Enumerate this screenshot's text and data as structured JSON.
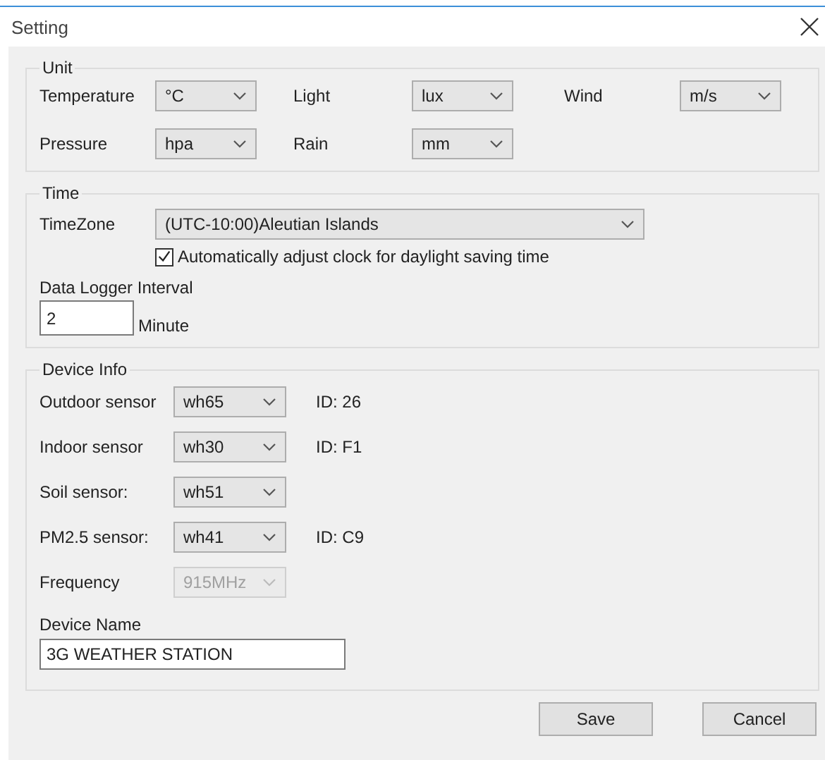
{
  "window": {
    "title": "Setting"
  },
  "unit": {
    "title": "Unit",
    "fields": [
      {
        "label": "Temperature",
        "value": "°C"
      },
      {
        "label": "Light",
        "value": "lux"
      },
      {
        "label": "Wind",
        "value": "m/s"
      },
      {
        "label": "Pressure",
        "value": "hpa"
      },
      {
        "label": "Rain",
        "value": "mm"
      }
    ]
  },
  "time": {
    "title": "Time",
    "timezone_label": "TimeZone",
    "timezone": "(UTC-10:00)Aleutian Islands",
    "dst": {
      "label": "Automatically adjust clock for daylight saving time",
      "checked": true
    },
    "interval_label": "Data Logger Interval",
    "interval": "2",
    "interval_unit": "Minute"
  },
  "device_info": {
    "title": "Device Info",
    "sensors": [
      {
        "label": "Outdoor sensor",
        "value": "wh65",
        "id": "ID: 26",
        "disabled": false
      },
      {
        "label": "Indoor sensor",
        "value": "wh30",
        "id": "ID: F1",
        "disabled": false
      },
      {
        "label": "Soil sensor:",
        "value": "wh51",
        "disabled": false
      },
      {
        "label": "PM2.5 sensor:",
        "value": "wh41",
        "id": "ID: C9",
        "disabled": false
      },
      {
        "label": "Frequency",
        "value": "915MHz",
        "disabled": true
      }
    ],
    "name_label": "Device Name",
    "name": "3G WEATHER STATION"
  },
  "buttons": [
    "Save",
    "Cancel"
  ]
}
